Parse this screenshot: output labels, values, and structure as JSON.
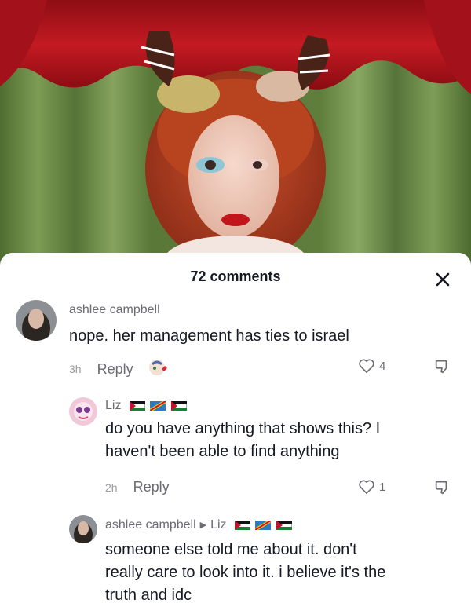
{
  "sheet": {
    "title": "72 comments"
  },
  "comments": [
    {
      "username": "ashlee campbell",
      "text": "nope. her management has ties to israel",
      "time": "3h",
      "reply_label": "Reply",
      "likes": "4"
    },
    {
      "username": "Liz",
      "text_line1": "do you have anything that shows this? I",
      "text_line2": "haven't been able to find anything",
      "time": "2h",
      "reply_label": "Reply",
      "likes": "1"
    },
    {
      "username": "ashlee campbell",
      "reply_to": "Liz",
      "text_line1": "someone else told me about it. don't",
      "text_line2": "really care to look into it. i believe it's the",
      "text_line3": "truth and idc"
    }
  ],
  "colors": {
    "curtain_red": "#b0141c",
    "curtain_green": "#6a8a45",
    "text": "#161823",
    "muted": "#8a8b91"
  },
  "icons": [
    "close-icon",
    "heart-icon",
    "dislike-icon",
    "gift-emoji-icon",
    "flag-icons"
  ]
}
